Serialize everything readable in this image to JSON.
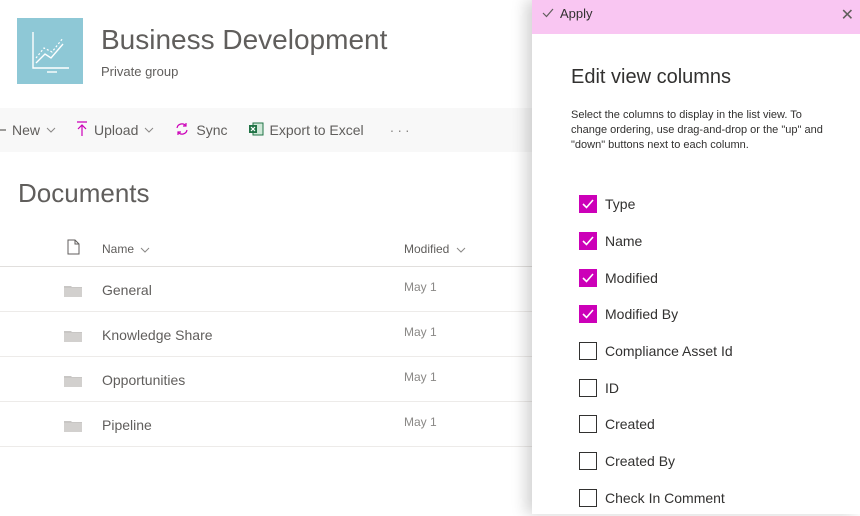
{
  "site": {
    "title": "Business Development",
    "subtitle": "Private group"
  },
  "commandbar": {
    "new_label": "New",
    "upload_label": "Upload",
    "sync_label": "Sync",
    "export_label": "Export to Excel",
    "more_label": "···"
  },
  "library": {
    "title": "Documents",
    "columns": {
      "name": "Name",
      "modified": "Modified"
    },
    "rows": [
      {
        "name": "General",
        "modified": "May 1"
      },
      {
        "name": "Knowledge Share",
        "modified": "May 1"
      },
      {
        "name": "Opportunities",
        "modified": "May 1"
      },
      {
        "name": "Pipeline",
        "modified": "May 1"
      }
    ]
  },
  "panel": {
    "apply_label": "Apply",
    "close_label": "✕",
    "title": "Edit view columns",
    "description": "Select the columns to display in the list view. To change ordering, use drag-and-drop or the \"up\" and \"down\" buttons next to each column.",
    "columns": [
      {
        "label": "Type",
        "checked": true
      },
      {
        "label": "Name",
        "checked": true
      },
      {
        "label": "Modified",
        "checked": true
      },
      {
        "label": "Modified By",
        "checked": true
      },
      {
        "label": "Compliance Asset Id",
        "checked": false
      },
      {
        "label": "ID",
        "checked": false
      },
      {
        "label": "Created",
        "checked": false
      },
      {
        "label": "Created By",
        "checked": false
      },
      {
        "label": "Check In Comment",
        "checked": false
      }
    ]
  },
  "colors": {
    "accent": "#cc00b8",
    "apply_bar": "#f9c6f2",
    "logo": "#8ec8d6",
    "commandbar": "#f8f8f8"
  },
  "icons": [
    "site-logo-chart-icon",
    "chevron-down-icon",
    "upload-icon",
    "sync-icon",
    "excel-icon",
    "more-icon",
    "file-icon",
    "folder-icon",
    "checkmark-icon",
    "close-icon"
  ]
}
